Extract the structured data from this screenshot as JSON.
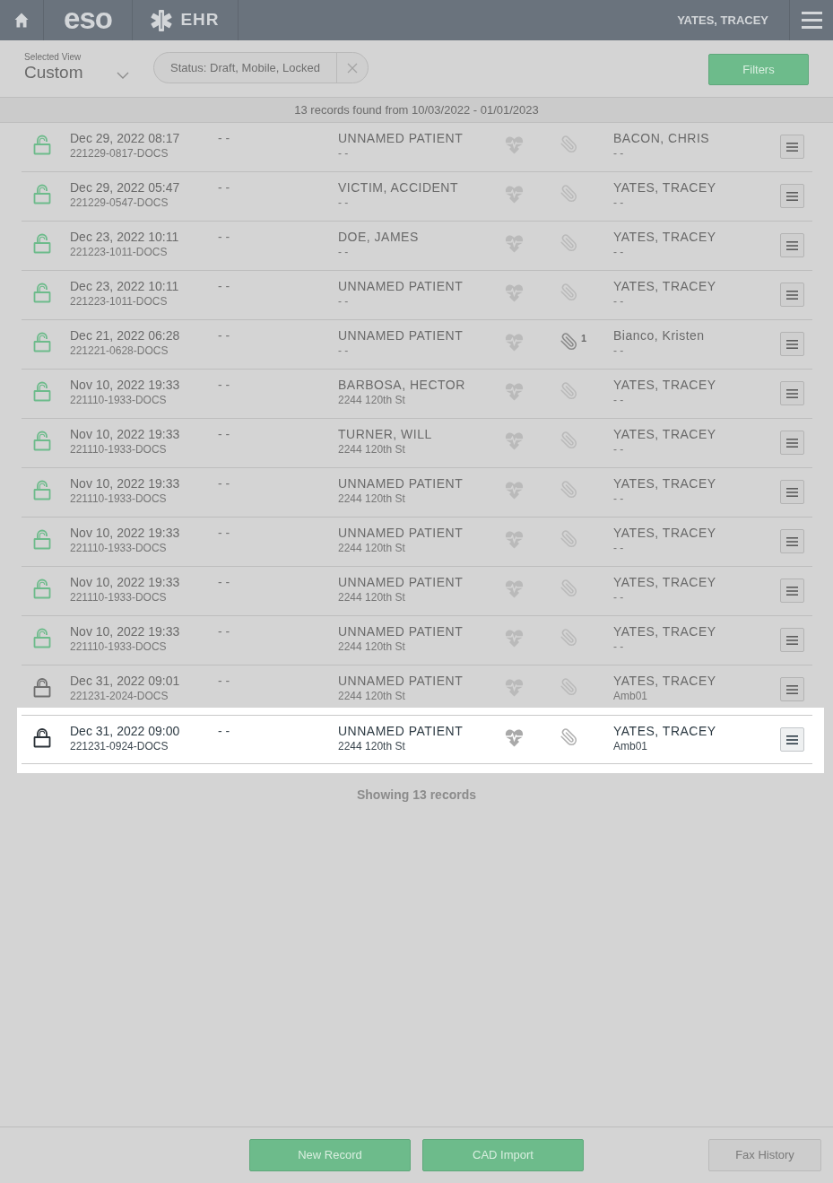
{
  "header": {
    "logo": "eso",
    "app": "EHR",
    "user": "YATES, TRACEY"
  },
  "view": {
    "label": "Selected View",
    "value": "Custom"
  },
  "filter_chip": {
    "label": "Status: Draft, Mobile, Locked"
  },
  "filters_button": "Filters",
  "summary": "13 records found from 10/03/2022 - 01/01/2023",
  "records": [
    {
      "date": "Dec 29, 2022 08:17",
      "number": "221229-0817-DOCS",
      "column_2": "- -",
      "patient": "UNNAMED PATIENT",
      "address": "- -",
      "crew": "BACON, CHRIS",
      "unit": "- -",
      "locked": false,
      "selected": false
    },
    {
      "date": "Dec 29, 2022 05:47",
      "number": "221229-0547-DOCS",
      "column_2": "- -",
      "patient": "VICTIM, ACCIDENT",
      "address": "- -",
      "crew": "YATES, TRACEY",
      "unit": "- -",
      "locked": false,
      "selected": false
    },
    {
      "date": "Dec 23, 2022 10:11",
      "number": "221223-1011-DOCS",
      "column_2": "- -",
      "patient": "DOE, JAMES",
      "address": "- -",
      "crew": "YATES, TRACEY",
      "unit": "- -",
      "locked": false,
      "selected": false
    },
    {
      "date": "Dec 23, 2022 10:11",
      "number": "221223-1011-DOCS",
      "column_2": "- -",
      "patient": "UNNAMED PATIENT",
      "address": "- -",
      "crew": "YATES, TRACEY",
      "unit": "- -",
      "locked": false,
      "selected": false
    },
    {
      "date": "Dec 21, 2022 06:28",
      "number": "221221-0628-DOCS",
      "column_2": "- -",
      "patient": "UNNAMED PATIENT",
      "address": "- -",
      "attachment_count": "1",
      "crew": "Bianco, Kristen",
      "unit": "- -",
      "locked": false,
      "selected": false
    },
    {
      "date": "Nov 10, 2022 19:33",
      "number": "221110-1933-DOCS",
      "column_2": "- -",
      "patient": "BARBOSA, HECTOR",
      "address": "2244 120th St",
      "crew": "YATES, TRACEY",
      "unit": "- -",
      "locked": false,
      "selected": false
    },
    {
      "date": "Nov 10, 2022 19:33",
      "number": "221110-1933-DOCS",
      "column_2": "- -",
      "patient": "TURNER, WILL",
      "address": "2244 120th St",
      "crew": "YATES, TRACEY",
      "unit": "- -",
      "locked": false,
      "selected": false
    },
    {
      "date": "Nov 10, 2022 19:33",
      "number": "221110-1933-DOCS",
      "column_2": "- -",
      "patient": "UNNAMED PATIENT",
      "address": "2244 120th St",
      "crew": "YATES, TRACEY",
      "unit": "- -",
      "locked": false,
      "selected": false
    },
    {
      "date": "Nov 10, 2022 19:33",
      "number": "221110-1933-DOCS",
      "column_2": "- -",
      "patient": "UNNAMED PATIENT",
      "address": "2244 120th St",
      "crew": "YATES, TRACEY",
      "unit": "- -",
      "locked": false,
      "selected": false
    },
    {
      "date": "Nov 10, 2022 19:33",
      "number": "221110-1933-DOCS",
      "column_2": "- -",
      "patient": "UNNAMED PATIENT",
      "address": "2244 120th St",
      "crew": "YATES, TRACEY",
      "unit": "- -",
      "locked": false,
      "selected": false
    },
    {
      "date": "Nov 10, 2022 19:33",
      "number": "221110-1933-DOCS",
      "column_2": "- -",
      "patient": "UNNAMED PATIENT",
      "address": "2244 120th St",
      "crew": "YATES, TRACEY",
      "unit": "- -",
      "locked": false,
      "selected": false
    },
    {
      "date": "Dec 31, 2022 09:01",
      "number": "221231-2024-DOCS",
      "column_2": "- -",
      "patient": "UNNAMED PATIENT",
      "address": "2244 120th St",
      "crew": "YATES, TRACEY",
      "unit": "Amb01",
      "locked": true,
      "selected": false
    },
    {
      "date": "Dec 31, 2022 09:00",
      "number": "221231-0924-DOCS",
      "column_2": "- -",
      "patient": "UNNAMED PATIENT",
      "address": "2244 120th St",
      "crew": "YATES, TRACEY",
      "unit": "Amb01",
      "locked": true,
      "selected": true
    }
  ],
  "footer_note": "Showing 13 records",
  "buttons": [
    {
      "label": "New Record",
      "kind": "primary"
    },
    {
      "label": "CAD Import",
      "kind": "primary"
    },
    {
      "label": "Fax History",
      "kind": "secondary"
    }
  ]
}
